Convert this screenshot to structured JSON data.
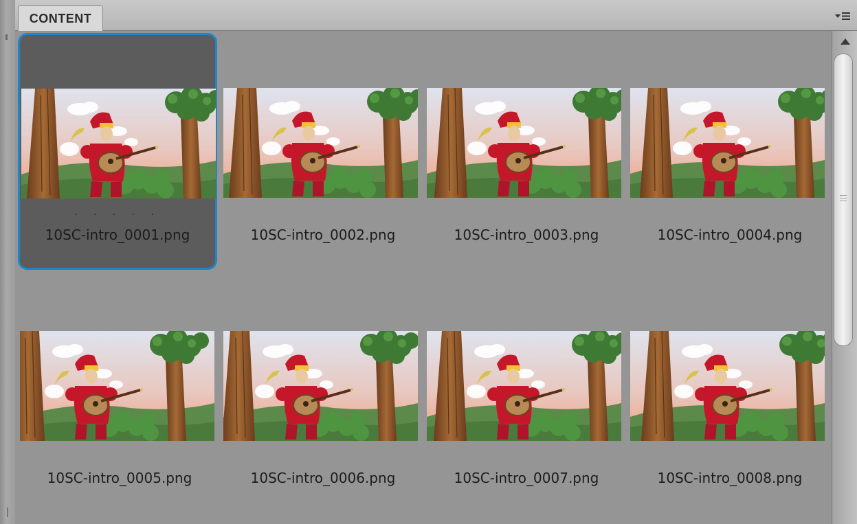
{
  "panel": {
    "tab_label": "CONTENT",
    "menu_icon": "panel-menu-icon"
  },
  "scrollbar": {
    "position": 0.0
  },
  "items": [
    {
      "name": "10SC-intro_0001.png",
      "selected": true,
      "dots": ". . . . ."
    },
    {
      "name": "10SC-intro_0002.png",
      "selected": false
    },
    {
      "name": "10SC-intro_0003.png",
      "selected": false
    },
    {
      "name": "10SC-intro_0004.png",
      "selected": false
    },
    {
      "name": "10SC-intro_0005.png",
      "selected": false
    },
    {
      "name": "10SC-intro_0006.png",
      "selected": false
    },
    {
      "name": "10SC-intro_0007.png",
      "selected": false
    },
    {
      "name": "10SC-intro_0008.png",
      "selected": false
    }
  ],
  "colors": {
    "selection_border": "#1e86c8",
    "panel_bg": "#959595"
  }
}
